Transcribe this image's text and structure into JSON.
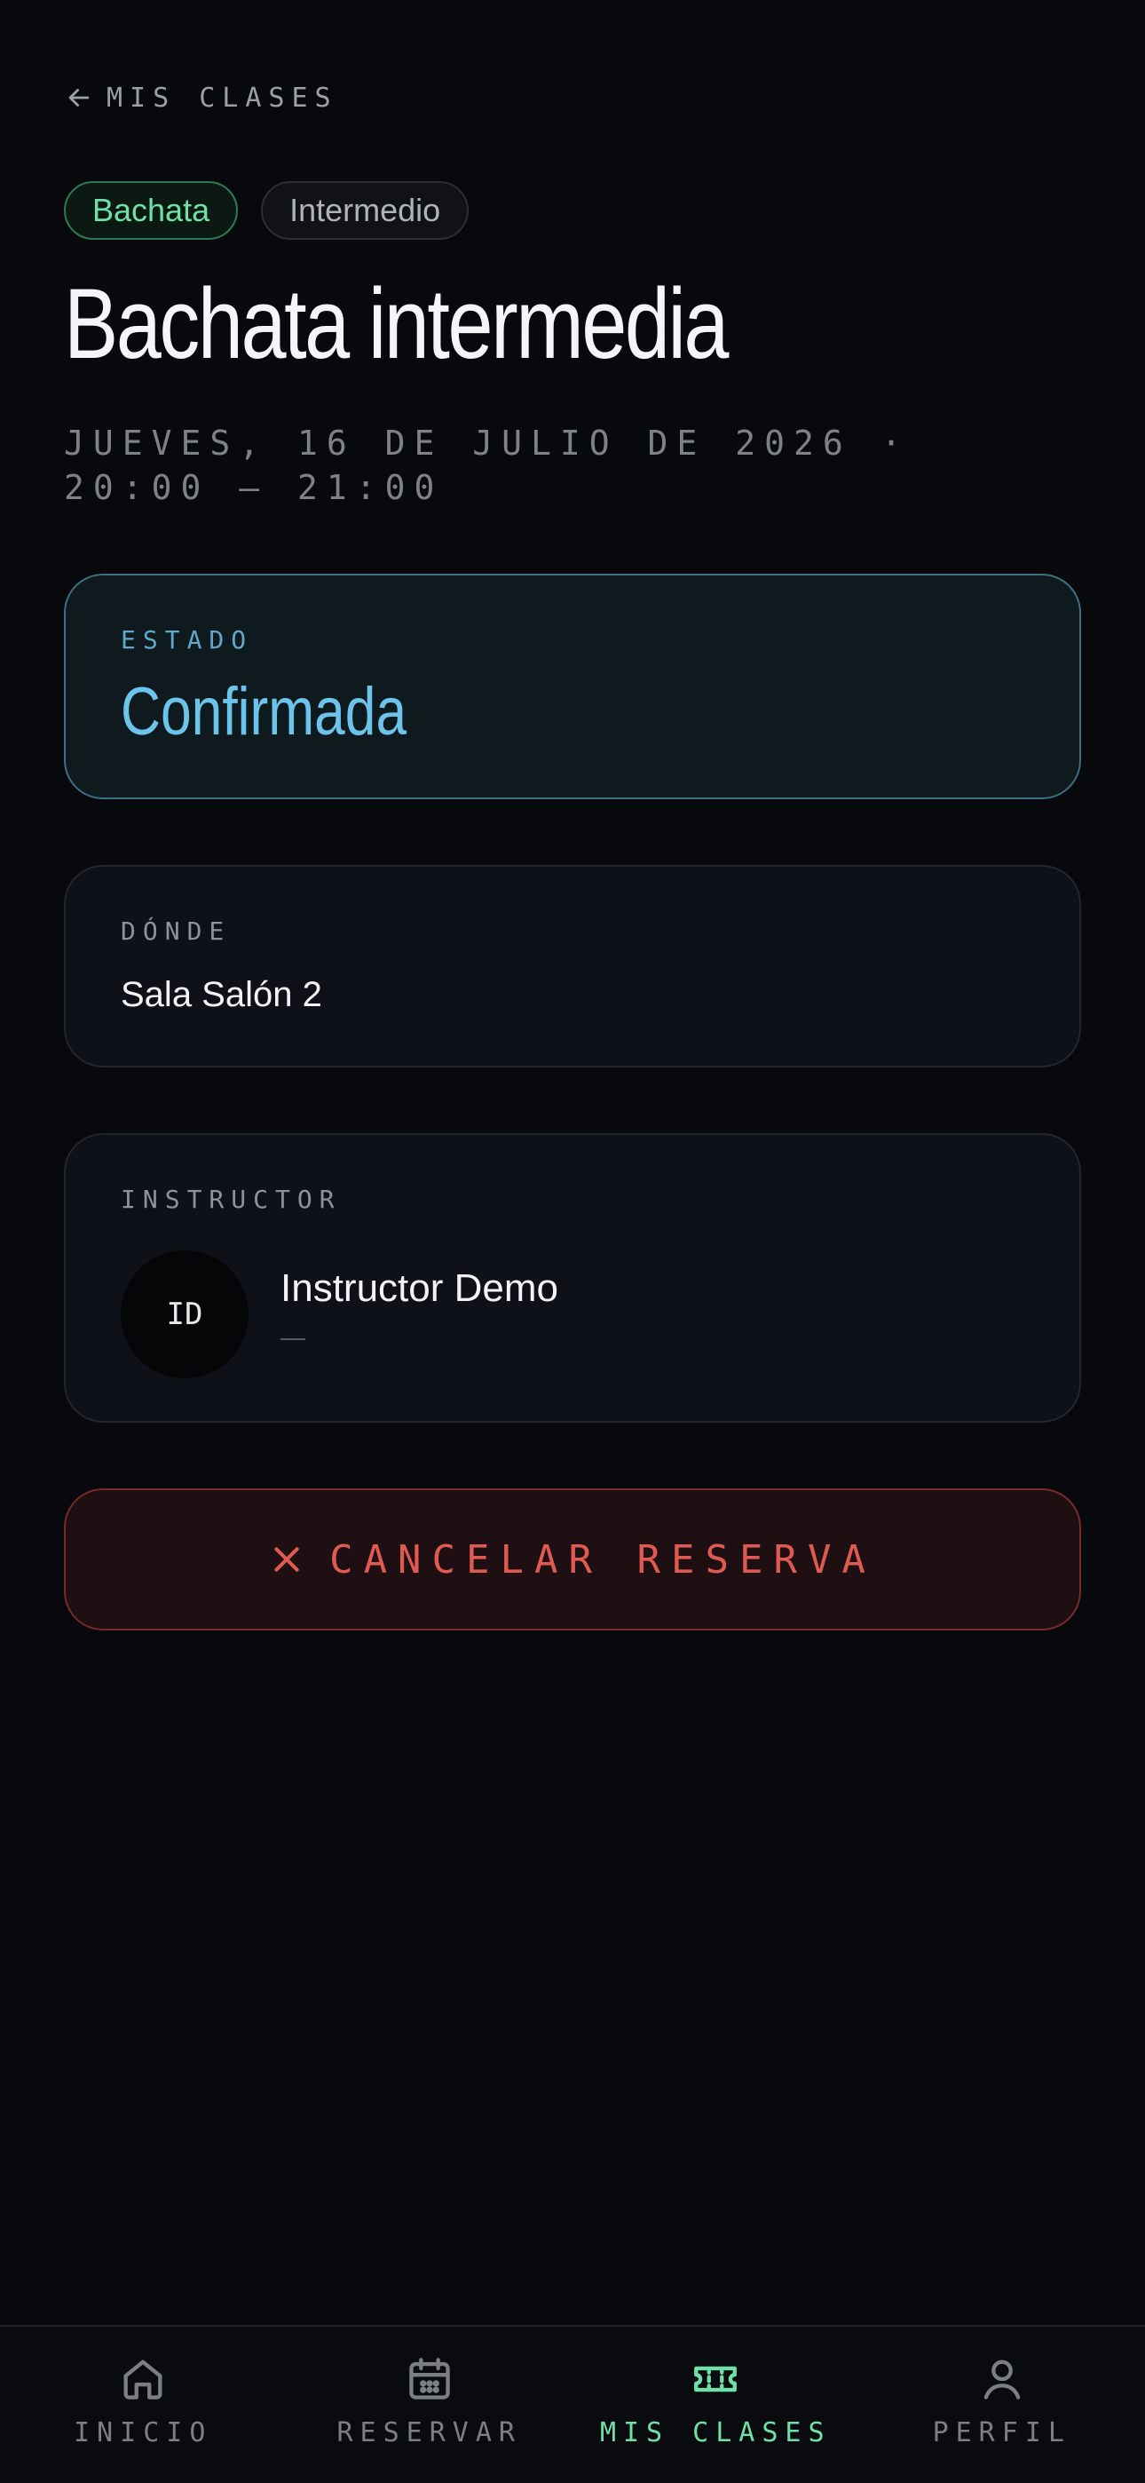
{
  "header": {
    "back_label": "MIS CLASES"
  },
  "tags": {
    "style": "Bachata",
    "level": "Intermedio"
  },
  "class": {
    "title": "Bachata intermedia",
    "datetime": "JUEVES, 16 DE JULIO DE 2026 · 20:00 — 21:00"
  },
  "status_card": {
    "label": "ESTADO",
    "value": "Confirmada"
  },
  "where_card": {
    "label": "DÓNDE",
    "value": "Sala Salón 2"
  },
  "instructor_card": {
    "label": "INSTRUCTOR",
    "initials": "ID",
    "name": "Instructor Demo",
    "detail": "—"
  },
  "actions": {
    "cancel_label": "CANCELAR RESERVA"
  },
  "tabbar": {
    "items": [
      {
        "label": "INICIO",
        "icon": "home-icon"
      },
      {
        "label": "RESERVAR",
        "icon": "calendar-icon"
      },
      {
        "label": "MIS CLASES",
        "icon": "ticket-icon",
        "active": true
      },
      {
        "label": "PERFIL",
        "icon": "user-icon"
      }
    ]
  },
  "colors": {
    "accent_green": "#6fe0a8",
    "status_blue": "#6cc4ea",
    "danger_red": "#e05a52",
    "background": "#08090d"
  }
}
